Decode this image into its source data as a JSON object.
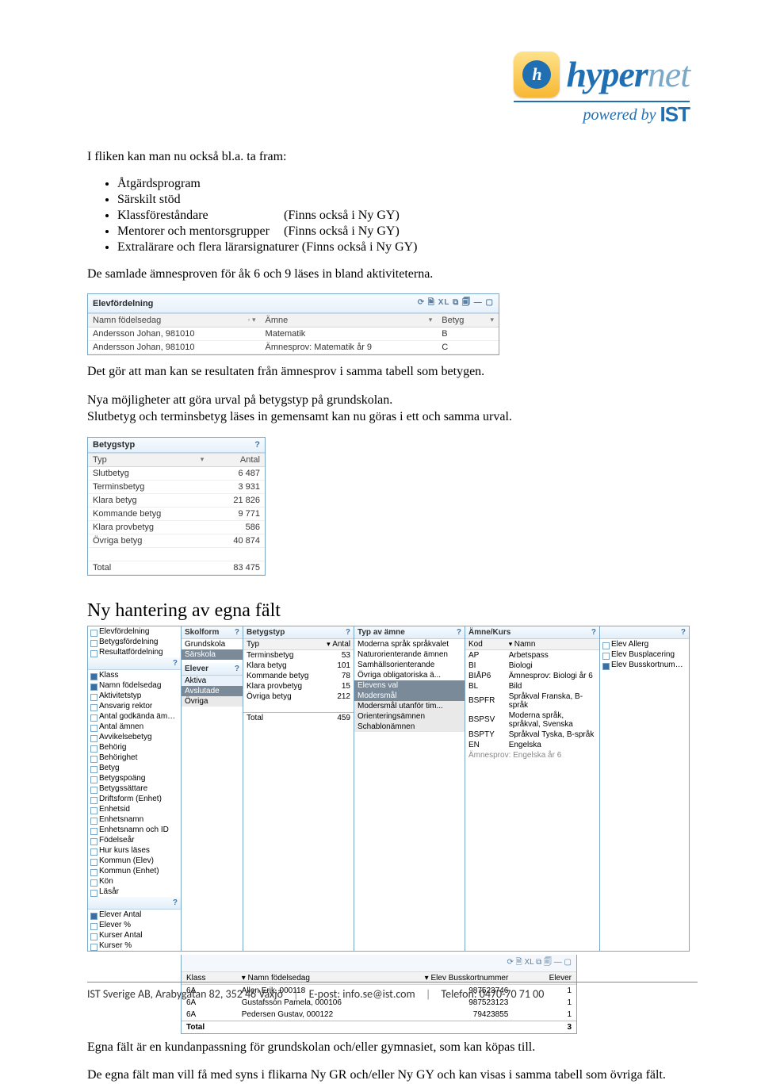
{
  "logo": {
    "brand_a": "hyper",
    "brand_b": "net",
    "icon_letter": "h",
    "powered": "powered by",
    "ist": "IST"
  },
  "intro": "I fliken kan man nu också bl.a. ta fram:",
  "bullets": [
    {
      "l": "Åtgärdsprogram",
      "r": ""
    },
    {
      "l": "Särskilt stöd",
      "r": ""
    },
    {
      "l": "Klassföreståndare",
      "r": "(Finns också i Ny GY)"
    },
    {
      "l": "Mentorer och mentorsgrupper",
      "r": "(Finns också i Ny GY)"
    },
    {
      "l": "Extralärare och flera lärarsignaturer (Finns också i Ny GY)",
      "r": ""
    }
  ],
  "para2": "De samlade ämnesproven för åk 6 och 9 läses in bland aktiviteterna.",
  "shot1": {
    "title": "Elevfördelning",
    "cols": [
      "Namn födelsedag",
      "Ämne",
      "Betyg"
    ],
    "rows": [
      [
        "Andersson Johan, 981010",
        "Matematik",
        "B"
      ],
      [
        "Andersson Johan, 981010",
        "Ämnesprov: Matematik år 9",
        "C"
      ]
    ]
  },
  "para3": "Det gör att man kan se resultaten från ämnesprov i samma tabell som betygen.",
  "para4a": "Nya möjligheter att göra urval på betygstyp på grundskolan.",
  "para4b": "Slutbetyg och terminsbetyg läses in gemensamt kan nu göras i ett och samma urval.",
  "shot2": {
    "title": "Betygstyp",
    "cols": [
      "Typ",
      "Antal"
    ],
    "rows": [
      [
        "Slutbetyg",
        "6 487"
      ],
      [
        "Terminsbetyg",
        "3 931"
      ],
      [
        "Klara betyg",
        "21 826"
      ],
      [
        "Kommande betyg",
        "9 771"
      ],
      [
        "Klara provbetyg",
        "586"
      ],
      [
        "Övriga betyg",
        "40 874"
      ]
    ],
    "total": [
      "Total",
      "83 475"
    ]
  },
  "section_h": "Ny hantering av egna fält",
  "shot3": {
    "col_a_head": "",
    "col_a_top": [
      "Elevfördelning",
      "Betygsfördelning",
      "Resultatfördelning"
    ],
    "col_a_items": [
      "Klass",
      "Namn födelsedag",
      "Aktivitetstyp",
      "Ansvarig rektor",
      "Antal godkända ämnen",
      "Antal ämnen",
      "Avvikelsebetyg",
      "Behörig",
      "Behörighet",
      "Betyg",
      "Betygspoäng",
      "Betygssättare",
      "Driftsform (Enhet)",
      "Enhetsid",
      "Enhetsnamn",
      "Enhetsnamn och ID",
      "Födelseår",
      "Hur kurs läses",
      "Kommun (Elev)",
      "Kommun (Enhet)",
      "Kön",
      "Läsår"
    ],
    "col_a_bottom": [
      "Elever Antal",
      "Elever %",
      "Kurser Antal",
      "Kurser %"
    ],
    "col_b": {
      "head": "Skolform",
      "items": [
        "Grundskola",
        "Särskola"
      ],
      "head2": "Elever",
      "items2": [
        "Aktiva",
        "Avslutade",
        "Övriga"
      ]
    },
    "col_c": {
      "head": "Betygstyp",
      "cols": [
        "Typ",
        "Antal"
      ],
      "rows": [
        [
          "Terminsbetyg",
          "53"
        ],
        [
          "Klara betyg",
          "101"
        ],
        [
          "Kommande betyg",
          "78"
        ],
        [
          "Klara provbetyg",
          "15"
        ],
        [
          "Övriga betyg",
          "212"
        ]
      ],
      "total": [
        "Total",
        "459"
      ]
    },
    "col_d": {
      "head": "Typ av ämne",
      "items": [
        "Moderna språk språkvalet",
        "Naturorienterande ämnen",
        "Samhällsorienterande",
        "Övriga obligatoriska ä...",
        "Elevens val",
        "Modersmål",
        "Modersmål utanför tim...",
        "Orienteringsämnen",
        "Schablonämnen"
      ]
    },
    "col_e": {
      "head": "Ämne/Kurs",
      "cols": [
        "Kod",
        "Namn"
      ],
      "rows": [
        [
          "AP",
          "Arbetspass"
        ],
        [
          "BI",
          "Biologi"
        ],
        [
          "BIÅP6",
          "Ämnesprov: Biologi år 6"
        ],
        [
          "BL",
          "Bild"
        ],
        [
          "BSPFR",
          "Språkval Franska, B-språk"
        ],
        [
          "BSPSV",
          "Moderna språk, språkval, Svenska"
        ],
        [
          "BSPTY",
          "Språkval Tyska, B-språk"
        ],
        [
          "EN",
          "Engelska"
        ]
      ],
      "last": "Ämnesprov: Engelska år 6"
    },
    "col_f": {
      "items": [
        "Elev Allerg",
        "Elev Busplacering",
        "Elev Busskortnummer"
      ]
    }
  },
  "shot3b": {
    "cols": [
      "Klass",
      "Namn födelsedag",
      "Elev Busskortnummer",
      "Elever"
    ],
    "rows": [
      [
        "6A",
        "Allen Erik, 000118",
        "987523746",
        "1"
      ],
      [
        "6A",
        "Gustafsson Pamela, 000106",
        "987523123",
        "1"
      ],
      [
        "6A",
        "Pedersen Gustav, 000122",
        "79423855",
        "1"
      ]
    ],
    "total": [
      "Total",
      "",
      "",
      "3"
    ]
  },
  "para5": "Egna fält är en kundanpassning för grundskolan och/eller gymnasiet, som kan köpas till.",
  "para6": "De egna fält man vill få med syns i flikarna Ny GR och/eller Ny GY och kan visas i samma tabell som övriga fält.",
  "footer": {
    "company": "IST Sverige AB, Arabygatan 82, 352 46 Växjö",
    "email_l": "E-post:",
    "email_v": "info.se@ist.com",
    "phone_l": "Telefon:",
    "phone_v": "0470-70 71 00"
  }
}
